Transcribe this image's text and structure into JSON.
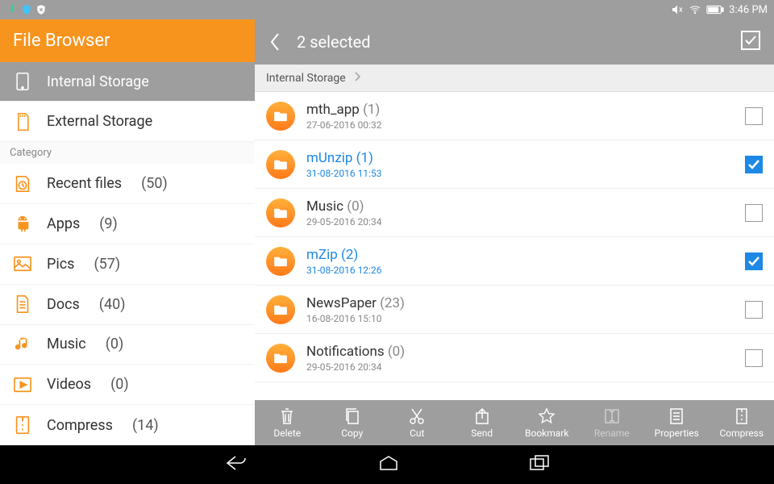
{
  "status": {
    "time": "3:46 PM"
  },
  "sidebar": {
    "title": "File Browser",
    "storage": [
      {
        "label": "Internal Storage",
        "active": true
      },
      {
        "label": "External Storage",
        "active": false
      }
    ],
    "category_label": "Category",
    "categories": [
      {
        "label": "Recent files",
        "count": "(50)"
      },
      {
        "label": "Apps",
        "count": "(9)"
      },
      {
        "label": "Pics",
        "count": "(57)"
      },
      {
        "label": "Docs",
        "count": "(40)"
      },
      {
        "label": "Music",
        "count": "(0)"
      },
      {
        "label": "Videos",
        "count": "(0)"
      },
      {
        "label": "Compress",
        "count": "(14)"
      }
    ]
  },
  "header": {
    "selected": "2 selected"
  },
  "breadcrumb": {
    "root": "Internal Storage"
  },
  "files": [
    {
      "name": "mth_app",
      "count": "(1)",
      "date": "27-06-2016 00:32",
      "selected": false
    },
    {
      "name": "mUnzip",
      "count": "(1)",
      "date": "31-08-2016 11:53",
      "selected": true
    },
    {
      "name": "Music",
      "count": "(0)",
      "date": "29-05-2016 20:34",
      "selected": false
    },
    {
      "name": "mZip",
      "count": "(2)",
      "date": "31-08-2016 12:26",
      "selected": true
    },
    {
      "name": "NewsPaper",
      "count": "(23)",
      "date": "16-08-2016 15:10",
      "selected": false
    },
    {
      "name": "Notifications",
      "count": "(0)",
      "date": "29-05-2016 20:34",
      "selected": false
    }
  ],
  "toolbar": [
    {
      "label": "Delete",
      "icon": "trash",
      "disabled": false
    },
    {
      "label": "Copy",
      "icon": "copy",
      "disabled": false
    },
    {
      "label": "Cut",
      "icon": "cut",
      "disabled": false
    },
    {
      "label": "Send",
      "icon": "send",
      "disabled": false
    },
    {
      "label": "Bookmark",
      "icon": "star",
      "disabled": false
    },
    {
      "label": "Rename",
      "icon": "rename",
      "disabled": true
    },
    {
      "label": "Properties",
      "icon": "props",
      "disabled": false
    },
    {
      "label": "Compress",
      "icon": "zip",
      "disabled": false
    }
  ]
}
